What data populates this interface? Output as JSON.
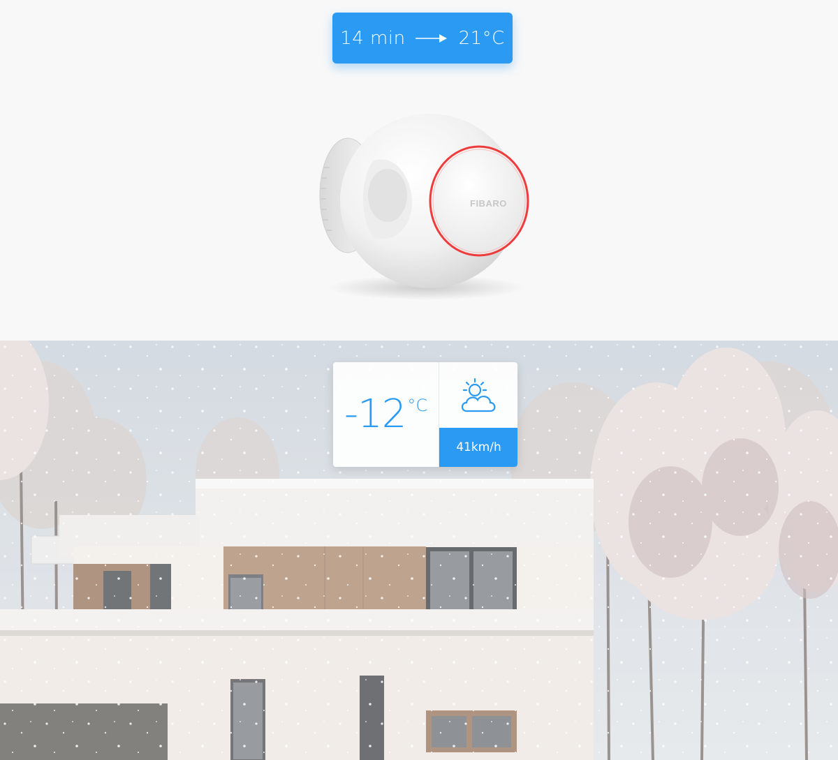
{
  "timer": {
    "duration": "14 min",
    "target": "21°C",
    "arrow_icon": "long-arrow-right-icon",
    "accent": "#2b9af3"
  },
  "device": {
    "brand": "FIBARO",
    "ring_color": "#ef3b3b"
  },
  "weather": {
    "temperature": "-12",
    "unit": "°C",
    "condition_icon": "partly-cloudy-icon",
    "wind_speed": "41km/h"
  }
}
